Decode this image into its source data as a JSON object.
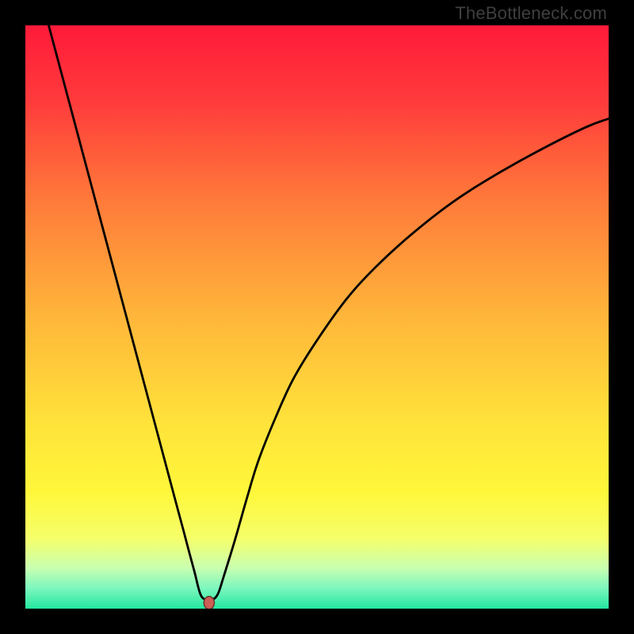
{
  "watermark": {
    "text": "TheBottleneck.com"
  },
  "chart_data": {
    "type": "line",
    "title": "",
    "xlabel": "",
    "ylabel": "",
    "xlim": [
      0,
      100
    ],
    "ylim": [
      0,
      100
    ],
    "grid": false,
    "background_gradient": {
      "direction": "vertical",
      "stops": [
        {
          "offset": 0.0,
          "color": "#ff1a3a"
        },
        {
          "offset": 0.13,
          "color": "#ff3b3b"
        },
        {
          "offset": 0.3,
          "color": "#ff7a3a"
        },
        {
          "offset": 0.5,
          "color": "#ffb63a"
        },
        {
          "offset": 0.68,
          "color": "#ffe23a"
        },
        {
          "offset": 0.8,
          "color": "#fff73a"
        },
        {
          "offset": 0.88,
          "color": "#f5ff6a"
        },
        {
          "offset": 0.93,
          "color": "#c9ffb0"
        },
        {
          "offset": 0.965,
          "color": "#7cf7bd"
        },
        {
          "offset": 1.0,
          "color": "#23e7a0"
        }
      ]
    },
    "series": [
      {
        "name": "bottleneck-curve",
        "color": "#000000",
        "stroke_width": 2.8,
        "x": [
          4,
          6,
          8,
          10,
          12,
          14,
          16,
          18,
          20,
          22,
          24,
          26,
          27,
          28,
          29,
          30,
          31,
          32,
          33,
          34,
          36,
          38,
          40,
          43,
          46,
          50,
          55,
          60,
          66,
          73,
          80,
          88,
          96,
          100
        ],
        "y": [
          100,
          92.5,
          85,
          77.5,
          70,
          62.5,
          55,
          47.5,
          40,
          32.5,
          25,
          17.5,
          13.8,
          10,
          6.3,
          2.5,
          1.5,
          1.5,
          2.5,
          5.5,
          12,
          19,
          25.5,
          33,
          39.5,
          46,
          53,
          58.5,
          64,
          69.5,
          74,
          78.5,
          82.5,
          84
        ]
      }
    ],
    "marker": {
      "name": "min-point",
      "x": 31.5,
      "y": 1.0,
      "rx": 0.9,
      "ry": 1.1,
      "fill": "#cc5e55",
      "stroke": "#6a2f2b"
    }
  }
}
